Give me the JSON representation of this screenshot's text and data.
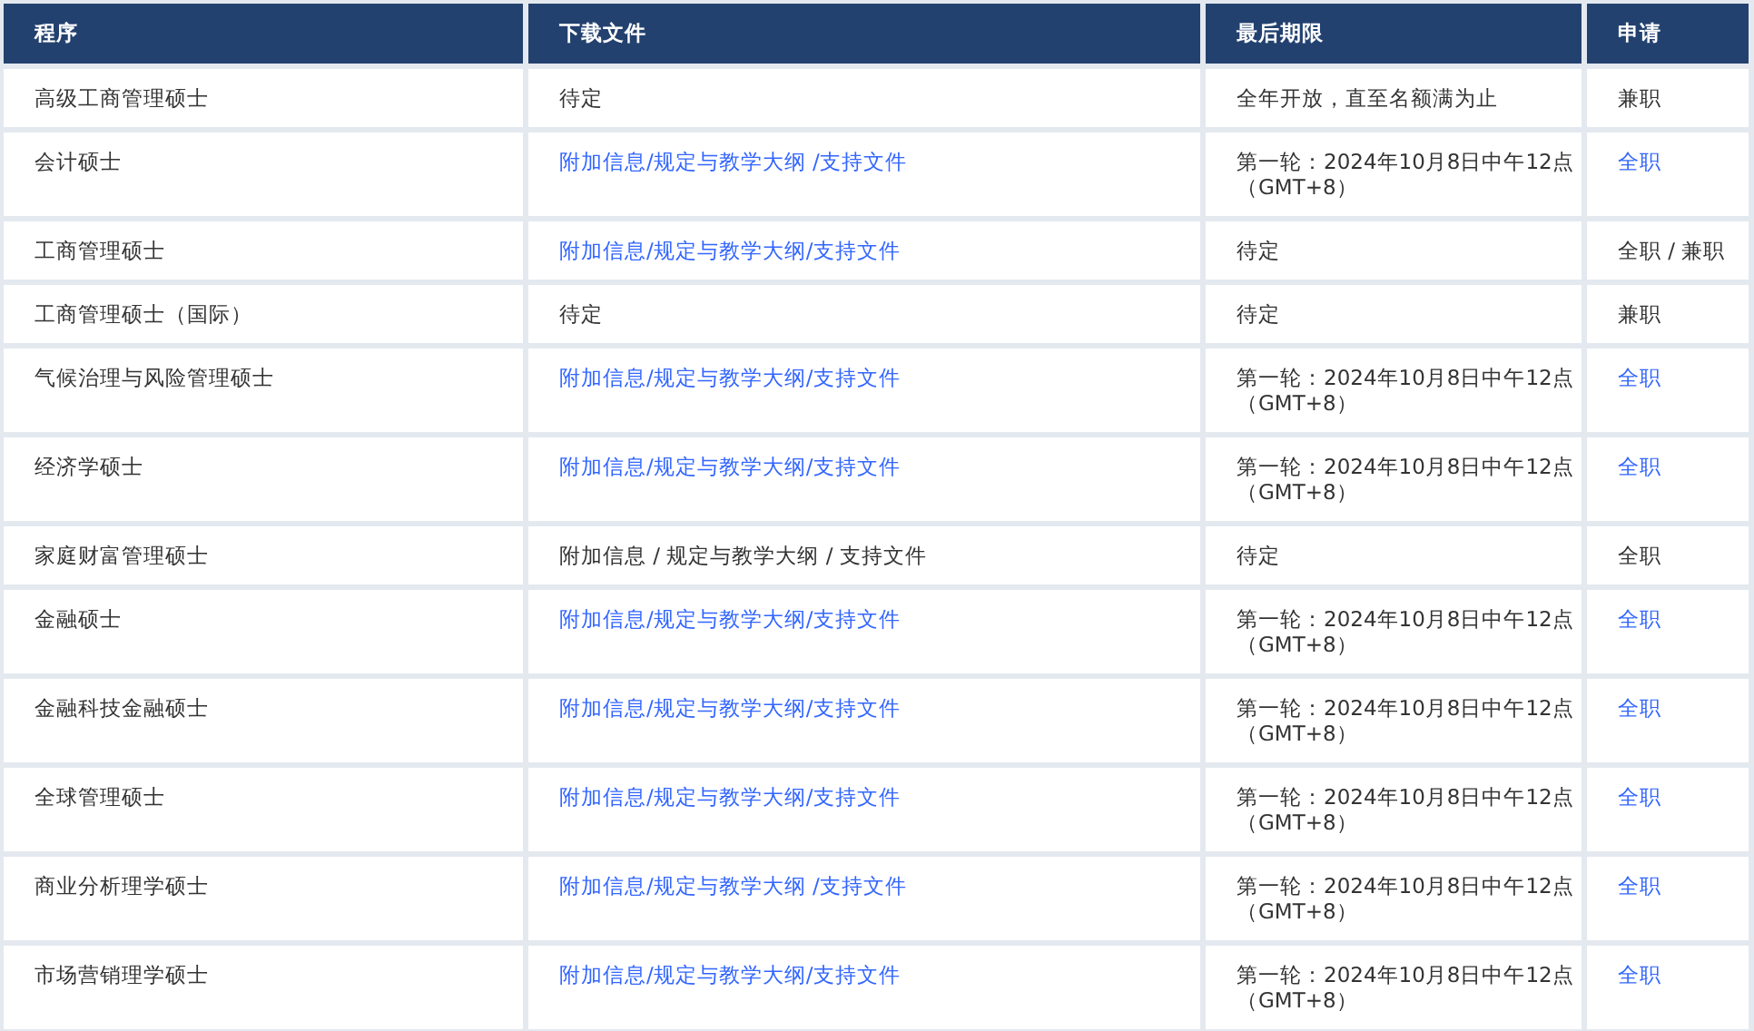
{
  "table": {
    "columns": [
      "程序",
      "下载文件",
      "最后期限",
      "申请"
    ],
    "rows": [
      {
        "program": "高级工商管理硕士",
        "downloads": {
          "kind": "text",
          "text": "待定"
        },
        "deadline": "全年开放，直至名额满为止",
        "apply": {
          "kind": "text",
          "text": "兼职"
        }
      },
      {
        "program": "会计硕士",
        "downloads": {
          "kind": "links",
          "links": [
            "附加信息",
            "规定与教学大纲",
            "支持文件"
          ],
          "separators": [
            "/",
            " /"
          ]
        },
        "deadline": "第一轮：2024年10月8日中午12点（GMT+8）",
        "apply": {
          "kind": "link",
          "text": "全职"
        }
      },
      {
        "program": "工商管理硕士",
        "downloads": {
          "kind": "links",
          "links": [
            "附加信息",
            "规定与教学大纲",
            "支持文件"
          ],
          "separators": [
            "/",
            "/"
          ]
        },
        "deadline": "待定",
        "apply": {
          "kind": "text",
          "text": "全职 / 兼职"
        }
      },
      {
        "program": "工商管理硕士（国际）",
        "downloads": {
          "kind": "text",
          "text": "待定"
        },
        "deadline": "待定",
        "apply": {
          "kind": "text",
          "text": "兼职"
        }
      },
      {
        "program": "气候治理与风险管理硕士",
        "downloads": {
          "kind": "links",
          "links": [
            "附加信息",
            "规定与教学大纲",
            "支持文件"
          ],
          "separators": [
            "/",
            "/"
          ]
        },
        "deadline": "第一轮：2024年10月8日中午12点（GMT+8）",
        "apply": {
          "kind": "link",
          "text": "全职"
        }
      },
      {
        "program": "经济学硕士",
        "downloads": {
          "kind": "links",
          "links": [
            "附加信息",
            "规定与教学大纲",
            "支持文件"
          ],
          "separators": [
            "/",
            "/"
          ]
        },
        "deadline": "第一轮：2024年10月8日中午12点（GMT+8）",
        "apply": {
          "kind": "link",
          "text": "全职"
        }
      },
      {
        "program": "家庭财富管理硕士",
        "downloads": {
          "kind": "text",
          "text": "附加信息 / 规定与教学大纲 / 支持文件"
        },
        "deadline": "待定",
        "apply": {
          "kind": "text",
          "text": "全职"
        }
      },
      {
        "program": "金融硕士",
        "downloads": {
          "kind": "links",
          "links": [
            "附加信息",
            "规定与教学大纲",
            "支持文件"
          ],
          "separators": [
            "/",
            "/"
          ]
        },
        "deadline": "第一轮：2024年10月8日中午12点（GMT+8）",
        "apply": {
          "kind": "link",
          "text": "全职"
        }
      },
      {
        "program": "金融科技金融硕士",
        "downloads": {
          "kind": "links",
          "links": [
            "附加信息",
            "规定与教学大纲",
            "支持文件"
          ],
          "separators": [
            "/",
            "/"
          ]
        },
        "deadline": "第一轮：2024年10月8日中午12点（GMT+8）",
        "apply": {
          "kind": "link",
          "text": "全职"
        }
      },
      {
        "program": "全球管理硕士",
        "downloads": {
          "kind": "links",
          "links": [
            "附加信息",
            "规定与教学大纲",
            "支持文件"
          ],
          "separators": [
            "/",
            "/"
          ]
        },
        "deadline": "第一轮：2024年10月8日中午12点（GMT+8）",
        "apply": {
          "kind": "link",
          "text": "全职"
        }
      },
      {
        "program": "商业分析理学硕士",
        "downloads": {
          "kind": "links",
          "links": [
            "附加信息",
            "规定与教学大纲",
            "支持文件"
          ],
          "separators": [
            "/",
            " /"
          ]
        },
        "deadline": "第一轮：2024年10月8日中午12点（GMT+8）",
        "apply": {
          "kind": "link",
          "text": "全职"
        }
      },
      {
        "program": "市场营销理学硕士",
        "downloads": {
          "kind": "links",
          "links": [
            "附加信息",
            "规定与教学大纲",
            "支持文件"
          ],
          "separators": [
            "/",
            "/"
          ]
        },
        "deadline": "第一轮：2024年10月8日中午12点（GMT+8）",
        "apply": {
          "kind": "link",
          "text": "全职"
        }
      }
    ]
  }
}
